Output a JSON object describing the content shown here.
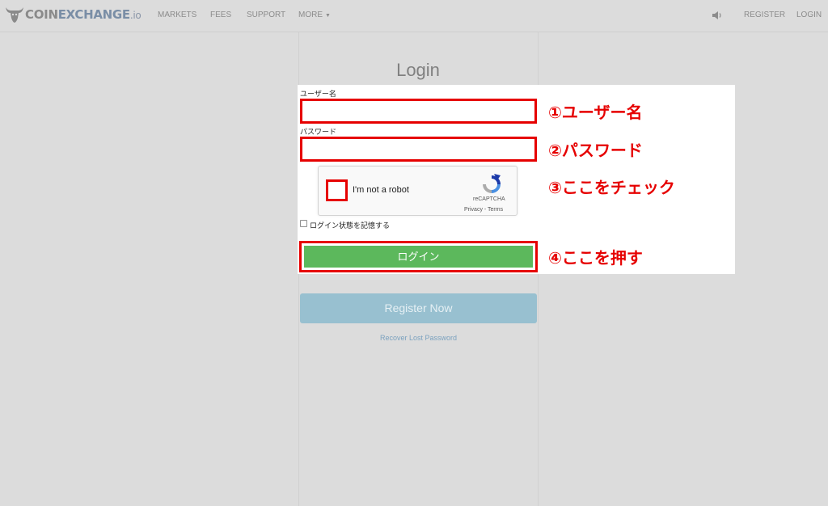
{
  "nav": {
    "brand_main": "COIN",
    "brand_accent": "EXCHANGE",
    "brand_suffix": ".io",
    "markets": "MARKETS",
    "fees": "FEES",
    "support": "SUPPORT",
    "more": "MORE",
    "register": "REGISTER",
    "login": "LOGIN"
  },
  "form": {
    "title": "Login",
    "username_label": "ユーザー名",
    "username_value": "",
    "password_label": "パスワード",
    "password_value": "",
    "remember_label": "ログイン状態を記憶する",
    "login_button": "ログイン",
    "register_button": "Register Now",
    "recover_link": "Recover Lost Password"
  },
  "captcha": {
    "label": "I'm not a robot",
    "brand": "reCAPTCHA",
    "terms": "Privacy - Terms"
  },
  "annotations": {
    "step1": "①ユーザー名",
    "step2": "②パスワード",
    "step3": "③ここをチェック",
    "step4": "④ここを押す"
  },
  "icons": {
    "logo": "bull-head-icon",
    "speaker": "speaker-icon",
    "more": "caret-down-icon",
    "captcha": "recaptcha-logo-icon"
  },
  "colors": {
    "annotation": "#e60000",
    "login_button": "#5cb85c",
    "register_button": "#98c0d0",
    "link": "#7ca2bf"
  }
}
